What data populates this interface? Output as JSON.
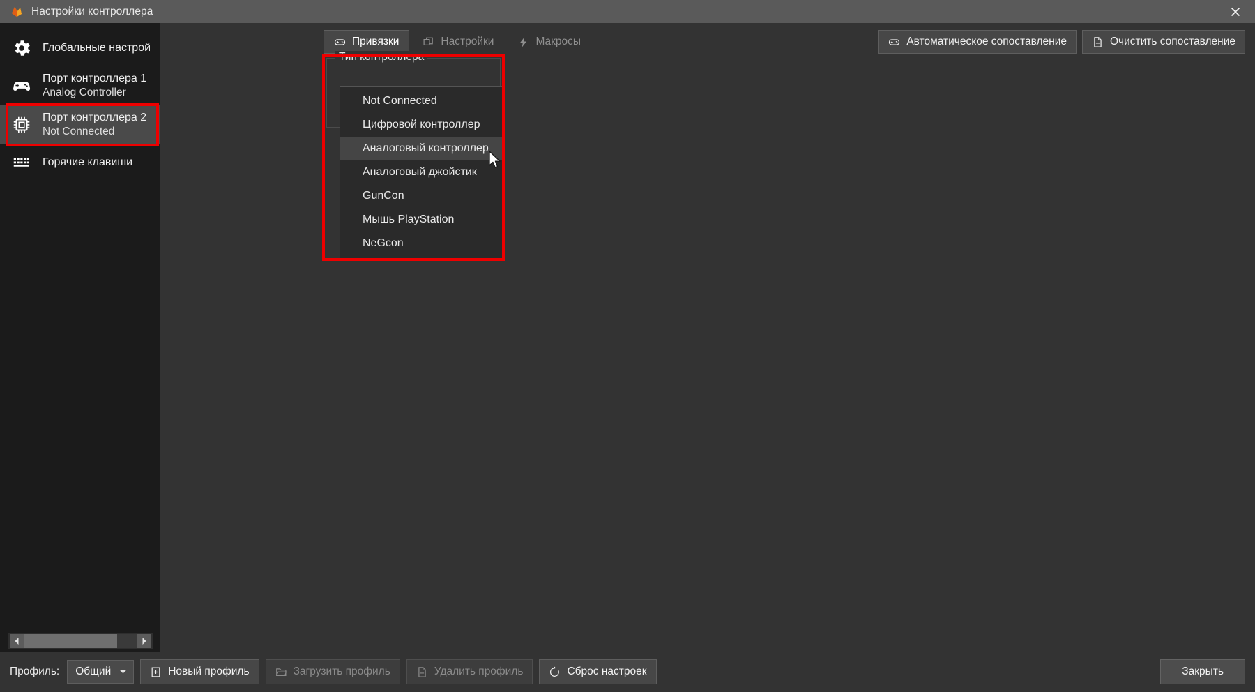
{
  "window": {
    "title": "Настройки контроллера",
    "app_icon": "duckstation-logo-icon",
    "close_icon": "close-icon"
  },
  "sidebar": {
    "items": [
      {
        "label": "Глобальные настрой",
        "sub": "",
        "icon": "gear-icon",
        "selected": false
      },
      {
        "label": "Порт контроллера 1",
        "sub": "Analog Controller",
        "icon": "gamepad-icon",
        "selected": false
      },
      {
        "label": "Порт контроллера 2",
        "sub": "Not Connected",
        "icon": "chip-icon",
        "selected": true
      },
      {
        "label": "Горячие клавиши",
        "sub": "",
        "icon": "keyboard-icon",
        "selected": false
      }
    ],
    "scrollbar": {
      "left_arrow_icon": "chevron-left-icon",
      "right_arrow_icon": "chevron-right-icon"
    }
  },
  "toolbar": {
    "tabs": [
      {
        "label": "Привязки",
        "icon": "gamepad-icon",
        "active": true
      },
      {
        "label": "Настройки",
        "icon": "windows-icon",
        "active": false
      },
      {
        "label": "Макросы",
        "icon": "lightning-icon",
        "active": false
      }
    ],
    "actions": [
      {
        "label": "Автоматическое сопоставление",
        "icon": "gamepad-icon"
      },
      {
        "label": "Очистить сопоставление",
        "icon": "document-minus-icon"
      }
    ]
  },
  "controller_type": {
    "group_title": "Тип контроллера",
    "selected_value": "Аналоговый контроллер",
    "options": [
      {
        "label": "Not Connected",
        "highlighted": false
      },
      {
        "label": "Цифровой контроллер",
        "highlighted": false
      },
      {
        "label": "Аналоговый контроллер",
        "highlighted": true
      },
      {
        "label": "Аналоговый джойстик",
        "highlighted": false
      },
      {
        "label": "GunCon",
        "highlighted": false
      },
      {
        "label": "Мышь PlayStation",
        "highlighted": false
      },
      {
        "label": "NeGcon",
        "highlighted": false
      }
    ]
  },
  "annotations": {
    "highlight_color": "#ee0000",
    "boxes": [
      {
        "name": "sidebar-port2-highlight"
      },
      {
        "name": "controller-type-dropdown-highlight"
      }
    ]
  },
  "bottom_bar": {
    "profile_label": "Профиль:",
    "profile_value": "Общий",
    "profile_caret_icon": "chevron-down-icon",
    "buttons": [
      {
        "label": "Новый профиль",
        "icon": "file-plus-icon",
        "disabled": false
      },
      {
        "label": "Загрузить профиль",
        "icon": "folder-open-icon",
        "disabled": true
      },
      {
        "label": "Удалить профиль",
        "icon": "file-minus-icon",
        "disabled": true
      },
      {
        "label": "Сброс настроек",
        "icon": "reset-circle-icon",
        "disabled": false
      }
    ],
    "close_label": "Закрыть"
  },
  "cursor": {
    "icon": "mouse-pointer-icon"
  }
}
